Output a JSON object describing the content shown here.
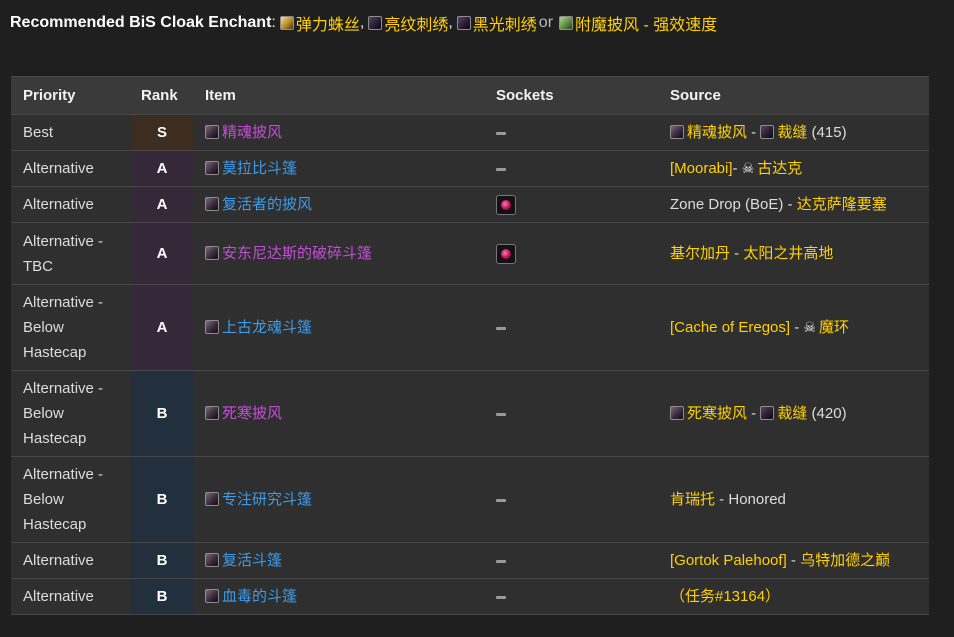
{
  "recommendation": {
    "label": "Recommended BiS Cloak Enchant",
    "separator": ":",
    "options": [
      {
        "icon": "scroll-icon",
        "name": "弹力蛛丝"
      },
      {
        "icon": "thread-icon",
        "name": "亮纹刺绣"
      },
      {
        "icon": "thread-icon",
        "name": "黑光刺绣"
      },
      {
        "icon": "enchant-icon",
        "name": "附魔披风 - 强效速度"
      }
    ],
    "comma": ",",
    "or_word": "or"
  },
  "table": {
    "headers": {
      "priority": "Priority",
      "rank": "Rank",
      "item": "Item",
      "sockets": "Sockets",
      "source": "Source"
    },
    "rows": [
      {
        "priority": "Best",
        "rank": "S",
        "item": "精魂披风",
        "item_quality": "epic",
        "socket": "none",
        "source": {
          "icon1": "cloak-icon",
          "part1": "精魂披风",
          "dash": " - ",
          "icon2": "thread-icon",
          "part2": "裁缝",
          "part3": " (415)"
        }
      },
      {
        "priority": "Alternative",
        "rank": "A",
        "item": "莫拉比斗篷",
        "item_quality": "rare",
        "socket": "none",
        "source": {
          "part1": "[Moorabi]",
          "dash": "- ",
          "skull": "☠",
          "part2": "古达克"
        }
      },
      {
        "priority": "Alternative",
        "rank": "A",
        "item": "复活者的披风",
        "item_quality": "rare",
        "socket": "red-gem",
        "source": {
          "part1": "Zone Drop (BoE)",
          "dash": " - ",
          "part2": "达克萨隆要塞"
        }
      },
      {
        "priority": "Alternative - TBC",
        "rank": "A",
        "item": "安东尼达斯的破碎斗篷",
        "item_quality": "epic",
        "socket": "red-gem",
        "source": {
          "part1": "基尔加丹",
          "dash": " - ",
          "part2": "太阳之井高地"
        }
      },
      {
        "priority": "Alternative - Below Hastecap",
        "rank": "A",
        "item": "上古龙魂斗篷",
        "item_quality": "rare",
        "socket": "none",
        "source": {
          "part1": "[Cache of Eregos]",
          "dash": " - ",
          "skull": "☠",
          "part2": "魔环"
        }
      },
      {
        "priority": "Alternative - Below Hastecap",
        "rank": "B",
        "item": "死寒披风",
        "item_quality": "epic",
        "socket": "none",
        "source": {
          "icon1": "cloak-icon",
          "part1": "死寒披风",
          "dash": " - ",
          "icon2": "thread-icon",
          "part2": "裁缝",
          "part3": " (420)"
        }
      },
      {
        "priority": "Alternative - Below Hastecap",
        "rank": "B",
        "item": "专注研究斗篷",
        "item_quality": "rare",
        "socket": "none",
        "source": {
          "part1": "肯瑞托",
          "dash": " - ",
          "part2": "Honored"
        }
      },
      {
        "priority": "Alternative",
        "rank": "B",
        "item": "复活斗篷",
        "item_quality": "rare",
        "socket": "none",
        "source": {
          "part1": "[Gortok Palehoof]",
          "dash": " - ",
          "part2": "乌特加德之巅"
        }
      },
      {
        "priority": "Alternative",
        "rank": "B",
        "item": "血毒的斗篷",
        "item_quality": "rare",
        "socket": "none",
        "source": {
          "part1": "（任务#13164）"
        }
      }
    ]
  },
  "colors": {
    "epic": "#c24fd6",
    "rare": "#3d9bea",
    "gold": "#ffd100",
    "rank_S": "#3c2d20",
    "rank_A": "#352839",
    "rank_B": "#22303e"
  }
}
